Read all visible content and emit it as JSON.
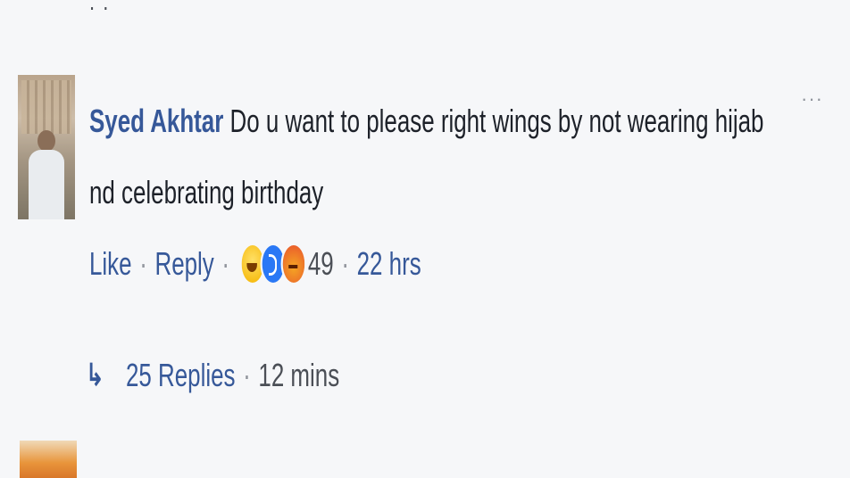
{
  "top_fragment": ". .",
  "comment": {
    "author": "Syed Akhtar",
    "text": "Do u want to please right wings by not wearing hijab nd celebrating birthday",
    "more_icon": "more-options-icon",
    "actions": {
      "like_label": "Like",
      "reply_label": "Reply",
      "reaction_icons": [
        "haha-icon",
        "like-icon",
        "angry-icon"
      ],
      "reaction_count": "49",
      "timestamp": "22 hrs",
      "separator": "·"
    },
    "replies": {
      "arrow_icon": "reply-arrow-icon",
      "label": "25 Replies",
      "timestamp": "12 mins"
    }
  },
  "colors": {
    "background": "#f6f7f9",
    "link": "#365899",
    "text": "#1d2129",
    "meta": "#4b4f56"
  }
}
